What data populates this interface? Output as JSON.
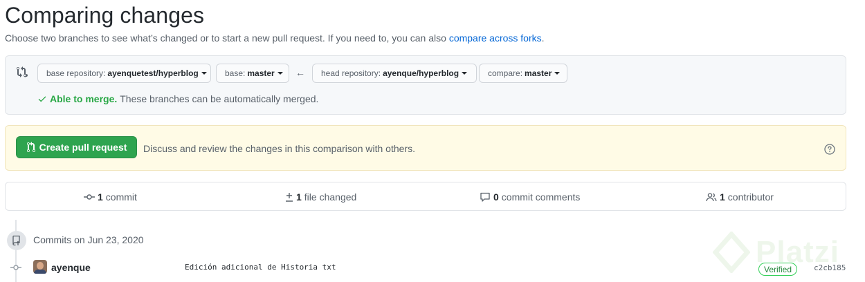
{
  "header": {
    "title": "Comparing changes",
    "subtitle": "Choose two branches to see what’s changed or to start a new pull request. If you need to, you can also",
    "subtitle_link": "compare across forks",
    "subtitle_end": "."
  },
  "range": {
    "base_repo_label": "base repository:",
    "base_repo_value": "ayenquetest/hyperblog",
    "base_label": "base:",
    "base_value": "master",
    "head_repo_label": "head repository:",
    "head_repo_value": "ayenque/hyperblog",
    "compare_label": "compare:",
    "compare_value": "master",
    "arrow": "←",
    "merge_ok": "Able to merge.",
    "merge_text": "These branches can be automatically merged."
  },
  "pull_request": {
    "button_label": "Create pull request",
    "description": "Discuss and review the changes in this comparison with others."
  },
  "stats": {
    "commits_count": "1",
    "commits_label": "commit",
    "files_count": "1",
    "files_label": "file changed",
    "comments_count": "0",
    "comments_label": "commit comments",
    "contributors_count": "1",
    "contributors_label": "contributor"
  },
  "commits": {
    "date_heading": "Commits on Jun 23, 2020",
    "items": [
      {
        "author": "ayenque",
        "message": "Edición adicional de Historia txt",
        "badge": "Verified",
        "sha": "c2cb185"
      }
    ]
  },
  "watermark": {
    "text": "Platzi"
  },
  "colors": {
    "accent_link": "#0366d6",
    "success": "#28a745",
    "button_green": "#2ea44f",
    "pr_box_bg": "#fffbe6"
  }
}
